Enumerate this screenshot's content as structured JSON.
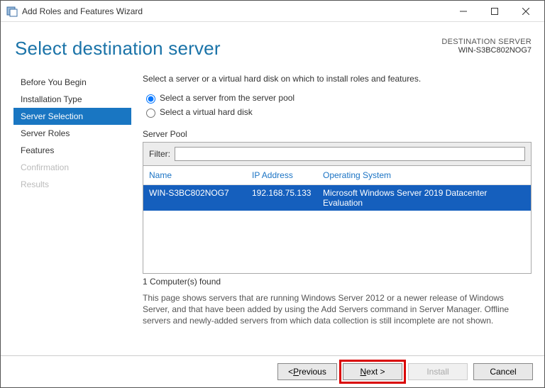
{
  "window": {
    "title": "Add Roles and Features Wizard"
  },
  "header": {
    "page_title": "Select destination server",
    "dest_label": "DESTINATION SERVER",
    "dest_value": "WIN-S3BC802NOG7"
  },
  "sidebar": {
    "items": [
      {
        "label": "Before You Begin",
        "selected": false,
        "disabled": false
      },
      {
        "label": "Installation Type",
        "selected": false,
        "disabled": false
      },
      {
        "label": "Server Selection",
        "selected": true,
        "disabled": false
      },
      {
        "label": "Server Roles",
        "selected": false,
        "disabled": false
      },
      {
        "label": "Features",
        "selected": false,
        "disabled": false
      },
      {
        "label": "Confirmation",
        "selected": false,
        "disabled": true
      },
      {
        "label": "Results",
        "selected": false,
        "disabled": true
      }
    ]
  },
  "content": {
    "instruction": "Select a server or a virtual hard disk on which to install roles and features.",
    "radio_pool": "Select a server from the server pool",
    "radio_vhd": "Select a virtual hard disk",
    "section_label": "Server Pool",
    "filter_label": "Filter:",
    "filter_value": "",
    "columns": {
      "name": "Name",
      "ip": "IP Address",
      "os": "Operating System"
    },
    "rows": [
      {
        "name": "WIN-S3BC802NOG7",
        "ip": "192.168.75.133",
        "os": "Microsoft Windows Server 2019 Datacenter Evaluation",
        "selected": true
      }
    ],
    "count": "1 Computer(s) found",
    "footer_text": "This page shows servers that are running Windows Server 2012 or a newer release of Windows Server, and that have been added by using the Add Servers command in Server Manager. Offline servers and newly-added servers from which data collection is still incomplete are not shown."
  },
  "buttons": {
    "previous": "< Previous",
    "next": "Next >",
    "install": "Install",
    "cancel": "Cancel"
  }
}
